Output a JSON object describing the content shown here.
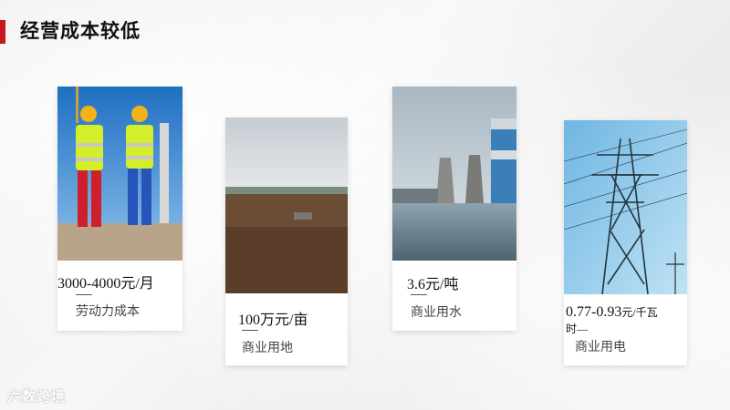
{
  "page": {
    "title": "经营成本较低"
  },
  "cards": [
    {
      "value": "3000-4000元/月",
      "label": "劳动力成本"
    },
    {
      "value": "100万元/亩",
      "label": "商业用地"
    },
    {
      "value": "3.6元/吨",
      "label": "商业用水"
    },
    {
      "value_main": "0.77-0.93",
      "value_small": "元/千瓦",
      "value_line2": "时—",
      "label": "商业用电"
    }
  ],
  "watermark": "六数跨境",
  "colors": {
    "accent": "#c8161d"
  }
}
